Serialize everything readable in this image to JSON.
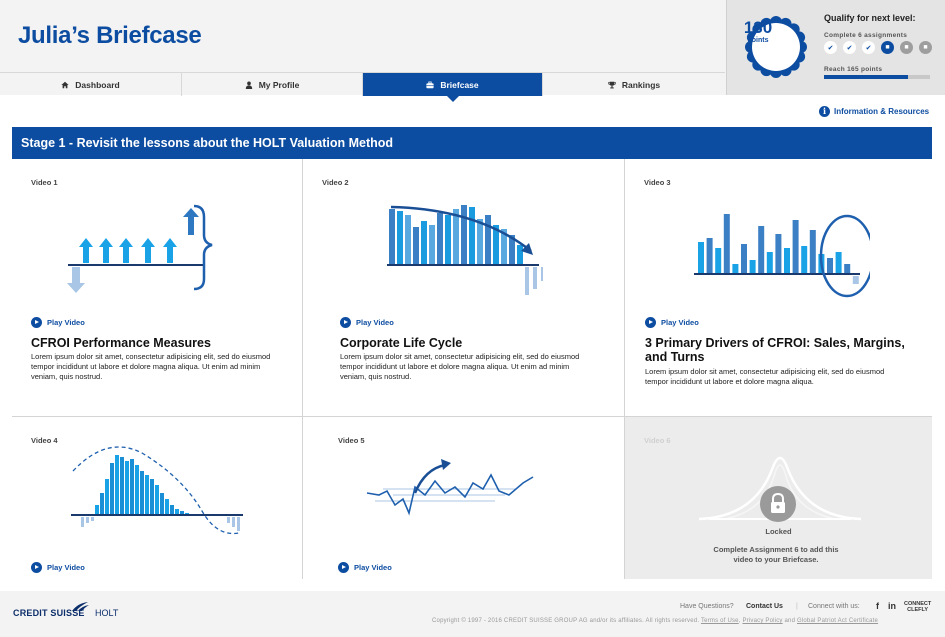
{
  "header": {
    "title": "Julia’s Briefcase",
    "nav": [
      {
        "label": "Dashboard",
        "icon": "home-icon",
        "active": false
      },
      {
        "label": "My Profile",
        "icon": "user-icon",
        "active": false
      },
      {
        "label": "Briefcase",
        "icon": "briefcase-icon",
        "active": true
      },
      {
        "label": "Rankings",
        "icon": "trophy-icon",
        "active": false
      }
    ]
  },
  "qualify": {
    "title": "Qualify for next level:",
    "points": "130",
    "points_unit": "points",
    "assignments_text": "Complete 6 assignments",
    "assignment_status": [
      "done",
      "done",
      "done",
      "current",
      "locked",
      "locked"
    ],
    "reach_text": "Reach 165 points",
    "progress_fraction": 0.79,
    "accent_color": "#0d4da1"
  },
  "info_link": {
    "label": "Information & Resources",
    "icon": "info-icon"
  },
  "stage": {
    "title": "Stage 1 - Revisit the lessons about the HOLT Valuation Method"
  },
  "videos": [
    {
      "label": "Video 1",
      "play": "Play Video",
      "title": "CFROI Performance Measures",
      "desc": "Lorem ipsum dolor sit amet, consectetur adipisicing elit, sed do eiusmod tempor incididunt ut labore et dolore magna aliqua. Ut enim ad minim veniam, quis nostrud."
    },
    {
      "label": "Video 2",
      "play": "Play Video",
      "title": "Corporate Life Cycle",
      "desc": "Lorem ipsum dolor sit amet, consectetur adipisicing elit, sed do eiusmod tempor incididunt ut labore et dolore magna aliqua. Ut enim ad minim veniam, quis nostrud."
    },
    {
      "label": "Video 3",
      "play": "Play Video",
      "title": "3 Primary Drivers of CFROI: Sales, Margins, and Turns",
      "desc": "Lorem ipsum dolor sit amet, consectetur adipisicing elit, sed do eiusmod tempor incididunt ut labore et dolore magna aliqua."
    },
    {
      "label": "Video 4",
      "play": "Play Video"
    },
    {
      "label": "Video 5",
      "play": "Play Video"
    },
    {
      "label": "Video 6",
      "locked_label": "Locked",
      "locked_message": "Complete Assignment 6 to add this video to your Briefcase."
    }
  ],
  "footer": {
    "logo_left": "CREDIT SUISSE",
    "logo_right": "HOLT",
    "questions": "Have Questions?",
    "contact": "Contact Us",
    "divider": "|",
    "connect": "Connect with us:",
    "facebook": "f",
    "linkedin": "in",
    "brand_line1": "CONNECT",
    "brand_line2": "CLEFLY",
    "copyright": "Copyright © 1997 - 2016 CREDIT SUISSE GROUP AG and/or its affiliates. All rights reserved.",
    "terms": "Terms of Use",
    "privacy": "Privacy Policy",
    "patriot": "Global Patriot Act Certificate",
    "sep1": ",",
    "sep2": "and"
  }
}
